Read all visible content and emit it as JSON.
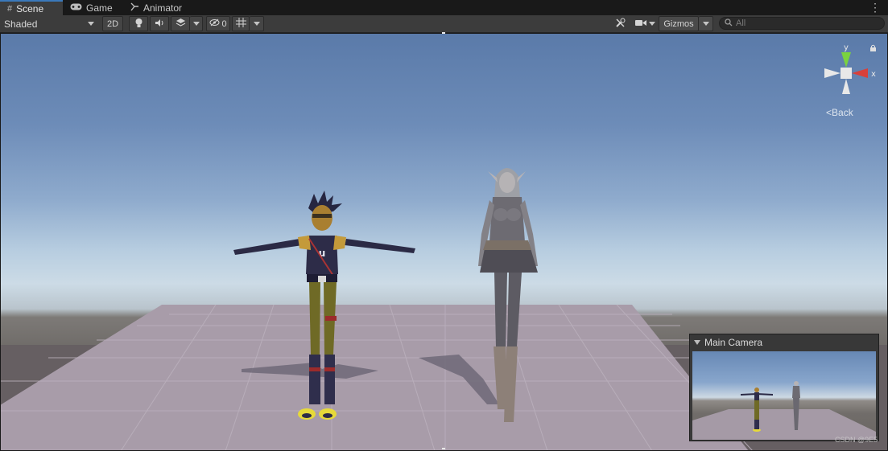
{
  "tabs": [
    {
      "label": "Scene",
      "icon": "grid-icon",
      "active": true
    },
    {
      "label": "Game",
      "icon": "gamepad-icon",
      "active": false
    },
    {
      "label": "Animator",
      "icon": "animator-icon",
      "active": false
    }
  ],
  "toolbar": {
    "shading_mode": "Shaded",
    "mode_2d": "2D",
    "hidden_count": "0",
    "gizmos_label": "Gizmos",
    "search_placeholder": "All"
  },
  "orientation_gizmo": {
    "y_label": "y",
    "x_label": "x",
    "back_label": "Back",
    "colors": {
      "x": "#d8403a",
      "y": "#7ad240",
      "neutral": "#e8e8e8"
    }
  },
  "camera_preview": {
    "title": "Main Camera"
  },
  "watermark": "CSDN @9E5",
  "colors": {
    "tab_active_accent": "#3a79bb",
    "toolbar_bg": "#3c3c3c",
    "grid_plane": "#a69aa8"
  }
}
